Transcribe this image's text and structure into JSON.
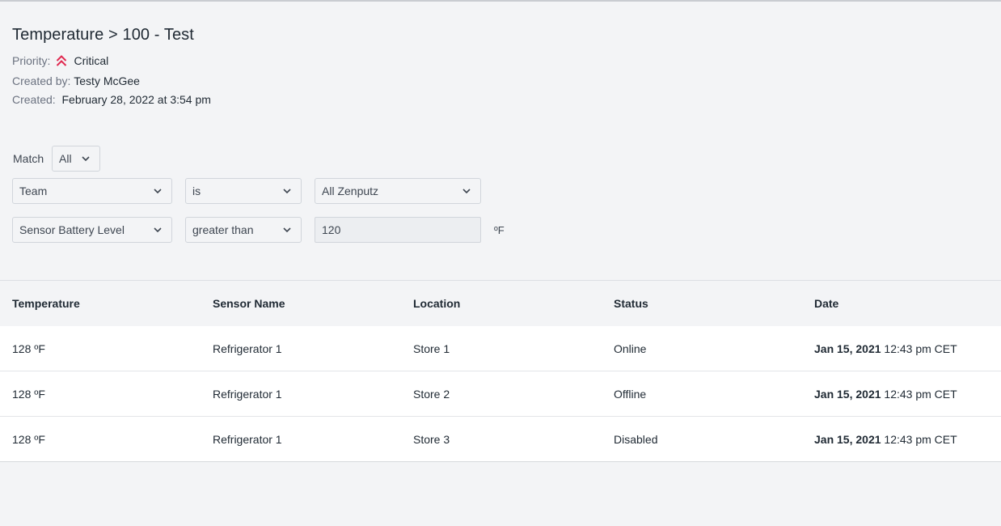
{
  "alert": {
    "title": "Temperature > 100 - Test",
    "priority_label": "Priority:",
    "priority_value": "Critical",
    "priority_color": "#e0284f",
    "created_by_label": "Created by:",
    "created_by_value": "Testy McGee",
    "created_label": "Created:",
    "created_value": "February 28, 2022 at 3:54 pm"
  },
  "filters": {
    "match_label": "Match",
    "match_value": "All",
    "rules": [
      {
        "field": "Team",
        "operator": "is",
        "value": "All Zenputz"
      },
      {
        "field": "Sensor Battery Level",
        "operator": "greater than",
        "value": "120",
        "unit": "ºF"
      }
    ]
  },
  "table": {
    "columns": [
      "Temperature",
      "Sensor Name",
      "Location",
      "Status",
      "Date"
    ],
    "rows": [
      {
        "temperature": "128 ºF",
        "sensor": "Refrigerator 1",
        "location": "Store 1",
        "status": "Online",
        "date": "Jan 15, 2021",
        "time": "12:43 pm CET"
      },
      {
        "temperature": "128 ºF",
        "sensor": "Refrigerator 1",
        "location": "Store 2",
        "status": "Offline",
        "date": "Jan 15, 2021",
        "time": "12:43 pm CET"
      },
      {
        "temperature": "128 ºF",
        "sensor": "Refrigerator 1",
        "location": "Store 3",
        "status": "Disabled",
        "date": "Jan 15, 2021",
        "time": "12:43 pm CET"
      }
    ]
  }
}
